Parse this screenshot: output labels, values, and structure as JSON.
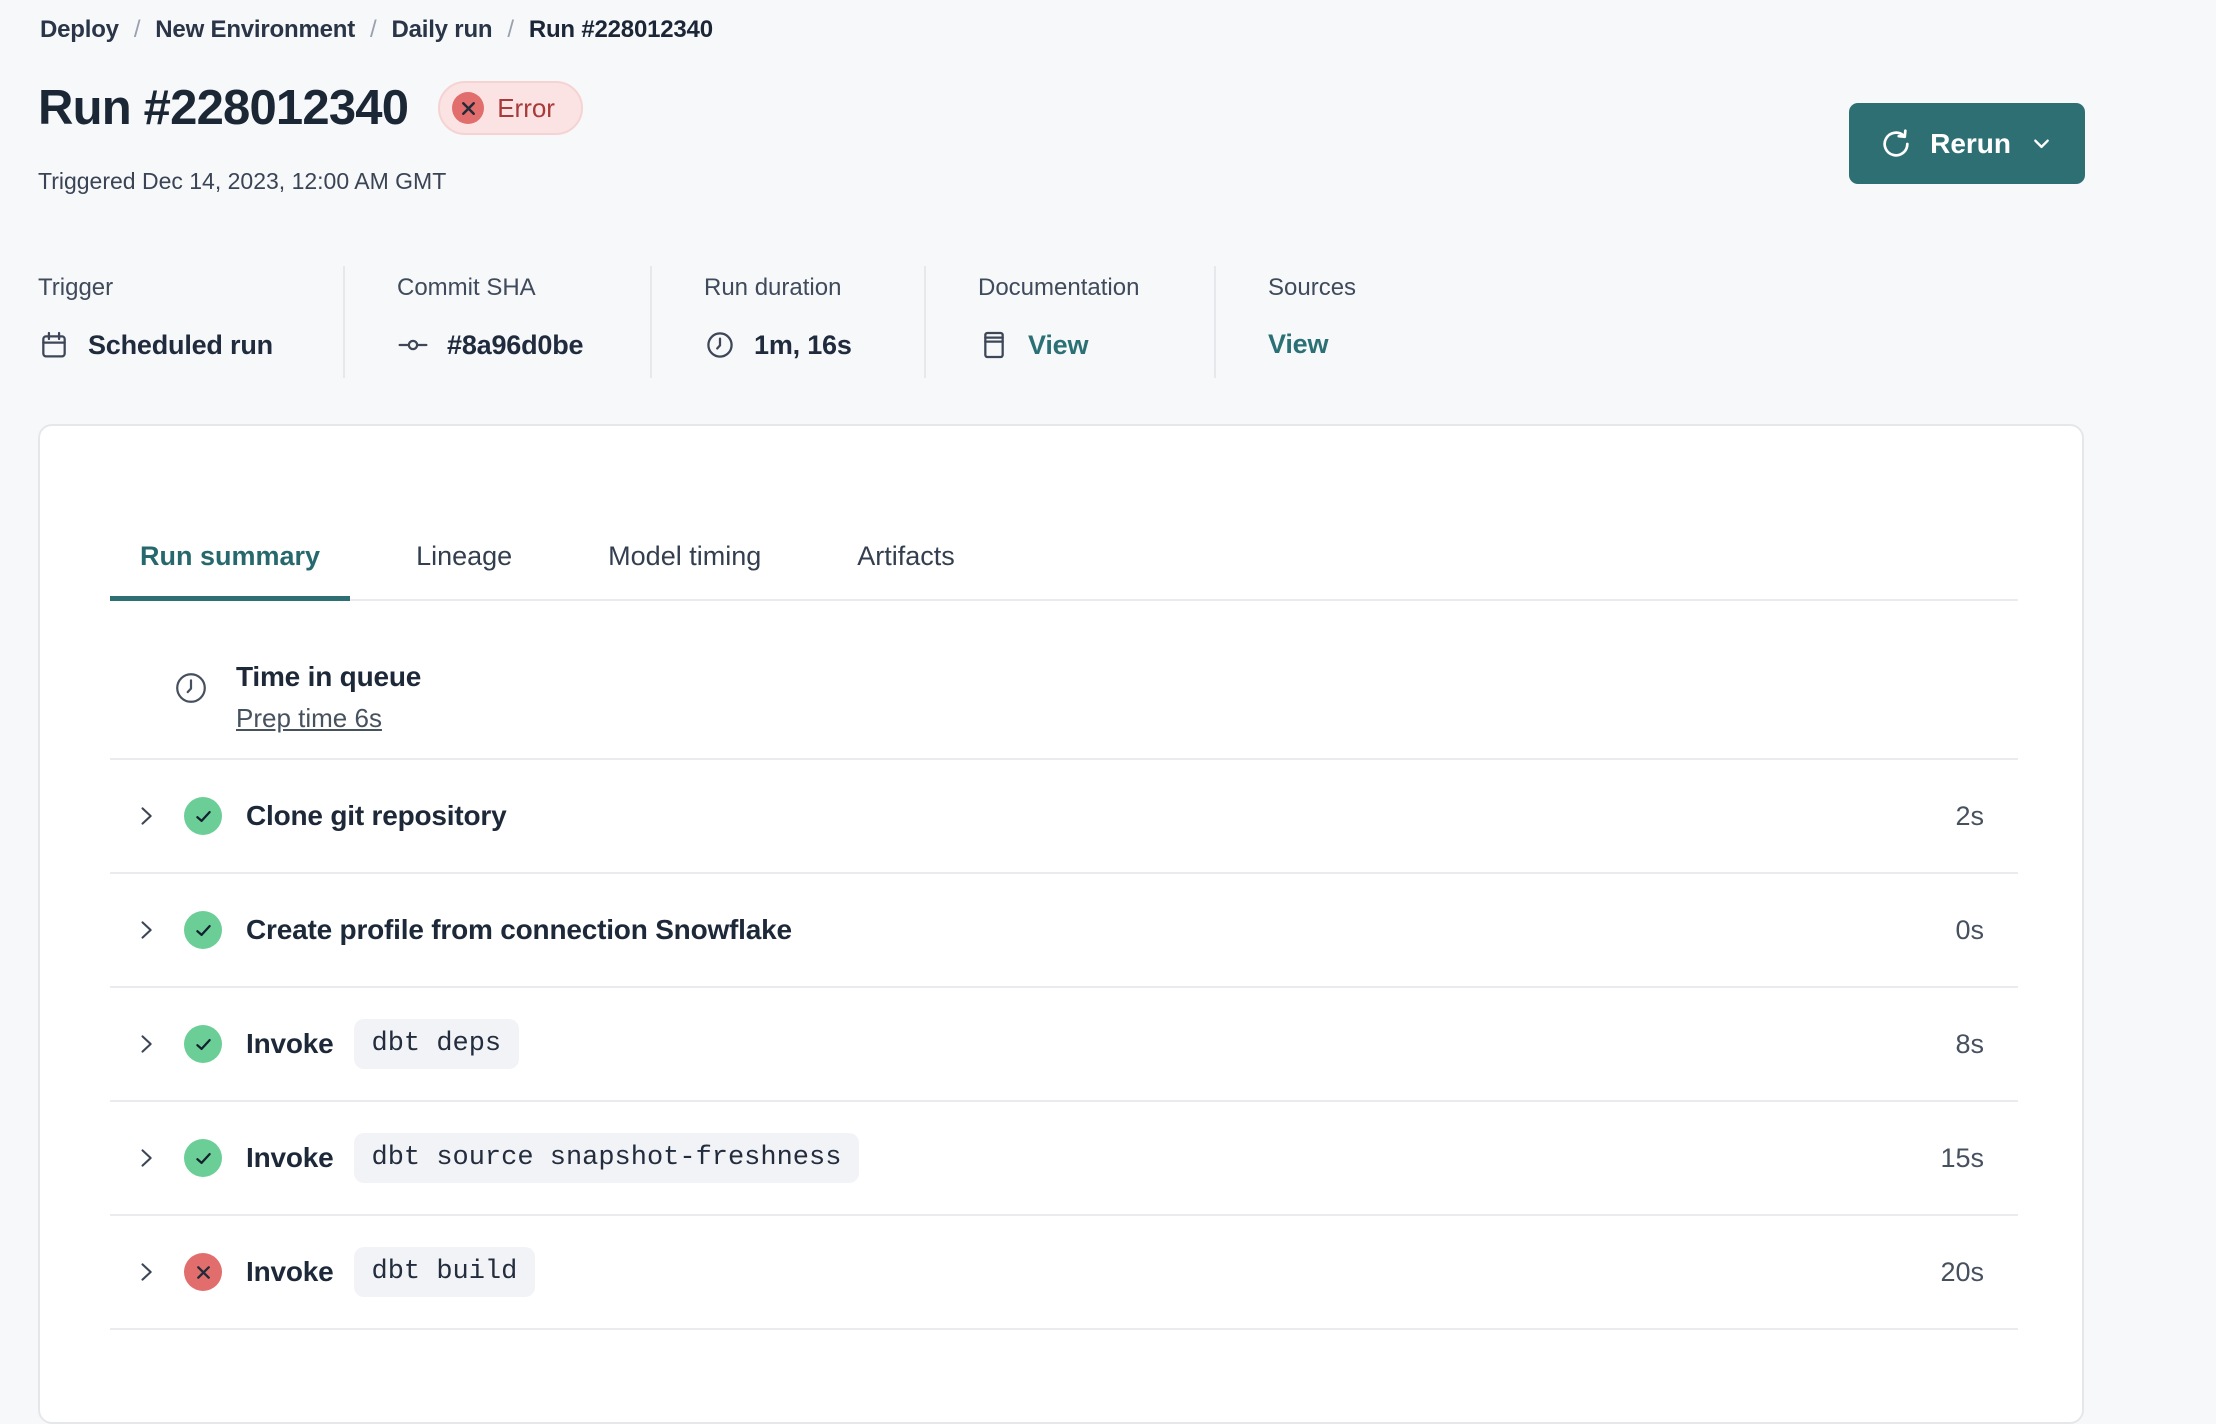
{
  "breadcrumb": {
    "separator": "/",
    "items": [
      {
        "label": "Deploy",
        "current": false
      },
      {
        "label": "New Environment",
        "current": false
      },
      {
        "label": "Daily run",
        "current": false
      },
      {
        "label": "Run #228012340",
        "current": true
      }
    ]
  },
  "header": {
    "title": "Run #228012340",
    "status_badge": "Error",
    "triggered": "Triggered Dec 14, 2023, 12:00 AM GMT",
    "rerun_button": "Rerun"
  },
  "meta": [
    {
      "label": "Trigger",
      "value": "Scheduled run",
      "icon": "calendar-icon",
      "link": false
    },
    {
      "label": "Commit SHA",
      "value": "#8a96d0be",
      "icon": "commit-icon",
      "link": false
    },
    {
      "label": "Run duration",
      "value": "1m, 16s",
      "icon": "clock-icon",
      "link": false
    },
    {
      "label": "Documentation",
      "value": "View",
      "icon": "docs-icon",
      "link": true
    },
    {
      "label": "Sources",
      "value": "View",
      "icon": null,
      "link": true
    }
  ],
  "tabs": [
    {
      "label": "Run summary",
      "active": true
    },
    {
      "label": "Lineage",
      "active": false
    },
    {
      "label": "Model timing",
      "active": false
    },
    {
      "label": "Artifacts",
      "active": false
    }
  ],
  "queue": {
    "title": "Time in queue",
    "link": "Prep time 6s"
  },
  "steps": [
    {
      "status": "success",
      "label": "Clone git repository",
      "command": "",
      "duration": "2s"
    },
    {
      "status": "success",
      "label": "Create profile from connection Snowflake",
      "command": "",
      "duration": "0s"
    },
    {
      "status": "success",
      "label": "Invoke",
      "command": "dbt deps",
      "duration": "8s"
    },
    {
      "status": "success",
      "label": "Invoke",
      "command": "dbt source snapshot-freshness",
      "duration": "15s"
    },
    {
      "status": "error",
      "label": "Invoke",
      "command": "dbt build",
      "duration": "20s"
    }
  ],
  "colors": {
    "accent_teal": "#2e6f74",
    "link_teal": "#2b7074",
    "success_green": "#6bce96",
    "error_red": "#e16d6d",
    "error_badge_bg": "#fbe3e3",
    "error_badge_text": "#a83a3a",
    "page_bg": "#f7f8fa"
  }
}
